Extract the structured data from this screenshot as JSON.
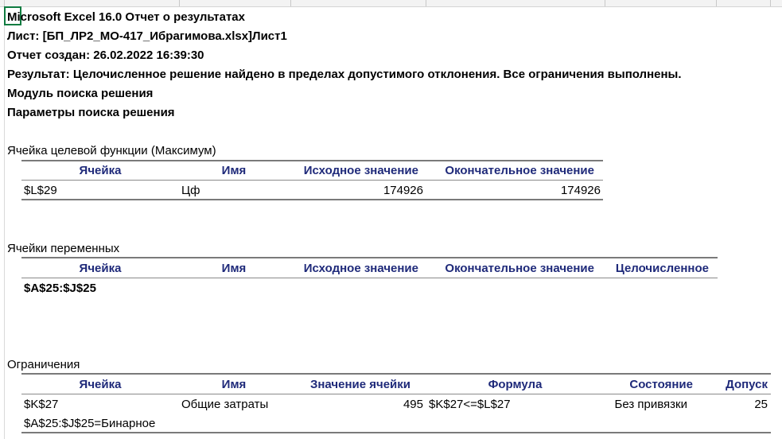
{
  "header": {
    "title": "Microsoft Excel 16.0 Отчет о результатах",
    "sheet": "Лист: [БП_ЛР2_МО-417_Ибрагимова.xlsx]Лист1",
    "created": "Отчет создан: 26.02.2022 16:39:30",
    "result": "Результат: Целочисленное решение найдено в пределах допустимого отклонения. Все ограничения выполнены.",
    "engine": "Модуль поиска решения",
    "params": "Параметры поиска решения"
  },
  "objective": {
    "section_title": "Ячейка целевой функции (Максимум)",
    "columns": [
      "Ячейка",
      "Имя",
      "Исходное значение",
      "Окончательное значение"
    ],
    "row": {
      "cell": "$L$29",
      "name": "Цф",
      "initial": "174926",
      "final": "174926"
    }
  },
  "variables": {
    "section_title": "Ячейки переменных",
    "columns": [
      "Ячейка",
      "Имя",
      "Исходное значение",
      "Окончательное значение",
      "Целочисленное"
    ],
    "group": "$A$25:$J$25"
  },
  "constraints": {
    "section_title": "Ограничения",
    "columns": [
      "Ячейка",
      "Имя",
      "Значение ячейки",
      "Формула",
      "Состояние",
      "Допуск"
    ],
    "row": {
      "cell": "$K$27",
      "name": "Общие затраты",
      "value": "495",
      "formula": "$K$27<=$L$27",
      "status": "Без привязки",
      "slack": "25"
    },
    "binary": "$A$25:$J$25=Бинарное"
  }
}
